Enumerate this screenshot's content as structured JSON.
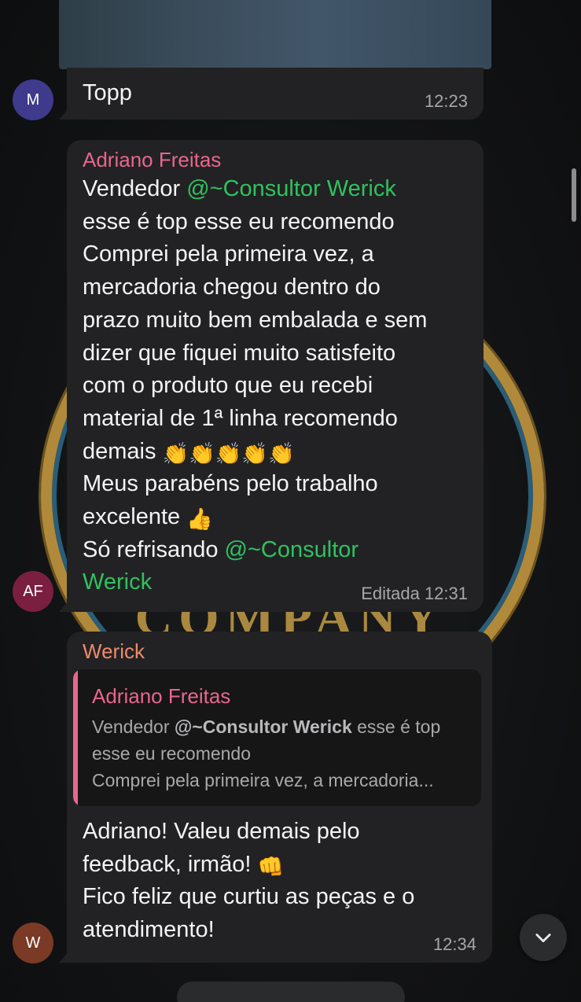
{
  "messages": [
    {
      "avatar_initials": "M",
      "avatar_color": "#3f3a8c",
      "text": "Topp",
      "time": "12:23"
    },
    {
      "avatar_initials": "AF",
      "avatar_color": "#7a1f3f",
      "sender": "Adriano Freitas",
      "sender_color": "#e8668d",
      "mention": "@~Consultor Werick",
      "mention_short": "@~Consultor",
      "mention_end": "Werick",
      "line1_prefix": "Vendedor ",
      "body": "esse é top esse eu recomendo\nComprei pela primeira vez, a\nmercadoria chegou dentro do\nprazo muito bem embalada e sem\ndizer que fiquei muito satisfeito\ncom o produto que eu recebi\nmaterial de 1ª linha recomendo",
      "demais": "demais",
      "emojis_clap": "👏👏👏👏👏",
      "body2": "Meus parabéns pelo trabalho",
      "excelente": "excelente",
      "emoji_thumbs": "👍",
      "refrisando": "Só refrisando ",
      "edited_label": "Editada",
      "time": "12:31"
    },
    {
      "avatar_initials": "W",
      "avatar_color": "#7a3a26",
      "sender": "Werick",
      "sender_color": "#f08a6a",
      "reply": {
        "sender": "Adriano Freitas",
        "line1_prefix": "Vendedor ",
        "line1_mention": "@~Consultor Werick",
        "line1_suffix": "  esse é top",
        "line2": "esse eu recomendo",
        "line3": "Comprei pela primeira vez, a mercadoria..."
      },
      "text1": "Adriano! Valeu demais pelo",
      "text2": "feedback, irmão! ",
      "emoji_fist": "👊",
      "text3": "Fico feliz que curtiu as peças e o\natendimento!",
      "time": "12:34"
    }
  ],
  "background": {
    "emblem_text": "COMPANY"
  },
  "colors": {
    "bubble_bg": "#222224",
    "mention": "#2fc25e",
    "timestamp": "#a7a7a9"
  },
  "icons": {
    "scroll_down": "chevron-down-icon"
  }
}
